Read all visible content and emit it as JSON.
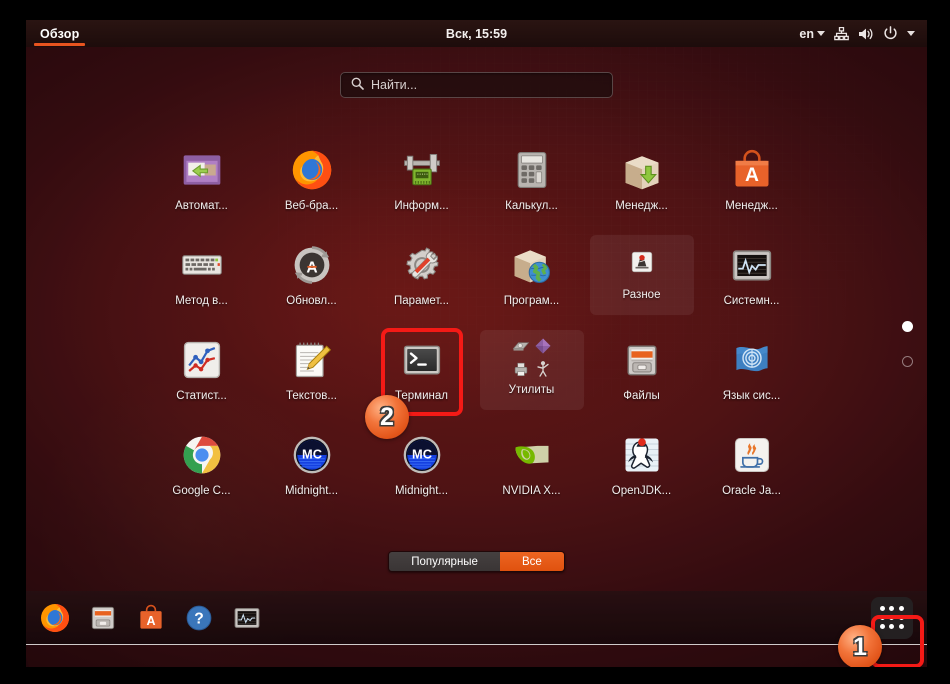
{
  "topbar": {
    "activities_label": "Обзор",
    "clock": "Вск, 15:59",
    "language": "en",
    "icons": [
      "language-caret-icon",
      "network-icon",
      "volume-icon",
      "power-icon",
      "system-menu-caret-icon"
    ]
  },
  "search": {
    "placeholder": "Найти...",
    "value": "",
    "icon": "search-icon"
  },
  "apps": [
    {
      "label": "Автомат...",
      "icon": "file-roller-archive-icon",
      "folder": false
    },
    {
      "label": "Веб-бра...",
      "icon": "firefox-icon",
      "folder": false
    },
    {
      "label": "Информ...",
      "icon": "hardware-info-caliper-icon",
      "folder": false
    },
    {
      "label": "Калькул...",
      "icon": "calculator-icon",
      "folder": false
    },
    {
      "label": "Менедж...",
      "icon": "package-update-manager-icon",
      "folder": false
    },
    {
      "label": "Менедж...",
      "icon": "ubuntu-software-bag-icon",
      "folder": false
    },
    {
      "label": "Метод в...",
      "icon": "keyboard-input-method-icon",
      "folder": false
    },
    {
      "label": "Обновл...",
      "icon": "software-updater-icon",
      "folder": false
    },
    {
      "label": "Парамет...",
      "icon": "settings-gear-wrench-icon",
      "folder": false
    },
    {
      "label": "Програм...",
      "icon": "software-sources-globe-box-icon",
      "folder": false
    },
    {
      "label": "Разное",
      "icon": "folder-misc-icon",
      "folder": true
    },
    {
      "label": "Системн...",
      "icon": "system-monitor-icon",
      "folder": false
    },
    {
      "label": "Статист...",
      "icon": "statistics-chart-icon",
      "folder": false
    },
    {
      "label": "Текстов...",
      "icon": "text-editor-notepad-icon",
      "folder": false
    },
    {
      "label": "Терминал",
      "icon": "terminal-icon",
      "folder": false
    },
    {
      "label": "Утилиты",
      "icon": "folder-utilities-icon",
      "folder": true
    },
    {
      "label": "Файлы",
      "icon": "nautilus-files-icon",
      "folder": false
    },
    {
      "label": "Язык сис...",
      "icon": "language-support-flag-icon",
      "folder": false
    },
    {
      "label": "Google C...",
      "icon": "google-chrome-icon",
      "folder": false
    },
    {
      "label": "Midnight...",
      "icon": "midnight-commander-icon",
      "folder": false
    },
    {
      "label": "Midnight...",
      "icon": "midnight-commander-icon",
      "folder": false
    },
    {
      "label": "NVIDIA X...",
      "icon": "nvidia-icon",
      "folder": false
    },
    {
      "label": "OpenJDK...",
      "icon": "openjdk-duke-icon",
      "folder": false
    },
    {
      "label": "Oracle Ja...",
      "icon": "java-coffee-icon",
      "folder": false
    }
  ],
  "pager": {
    "pages": 2,
    "current": 1
  },
  "filter": {
    "popular_label": "Популярные",
    "all_label": "Все",
    "selected": "Все"
  },
  "dock": {
    "items": [
      {
        "name": "firefox",
        "icon": "firefox-icon"
      },
      {
        "name": "files",
        "icon": "nautilus-files-icon"
      },
      {
        "name": "ubuntu-software",
        "icon": "ubuntu-software-bag-icon"
      },
      {
        "name": "help",
        "icon": "help-question-icon"
      },
      {
        "name": "system-monitor",
        "icon": "system-monitor-icon"
      }
    ],
    "apps_button_icon": "apps-grid-icon"
  },
  "annotations": [
    {
      "id": "1",
      "target": "apps-grid-button"
    },
    {
      "id": "2",
      "target": "app-terminal"
    }
  ],
  "colors": {
    "accent_orange": "#e8541f",
    "annotation_red": "#f41a16",
    "badge_orange": "#e2551a"
  }
}
